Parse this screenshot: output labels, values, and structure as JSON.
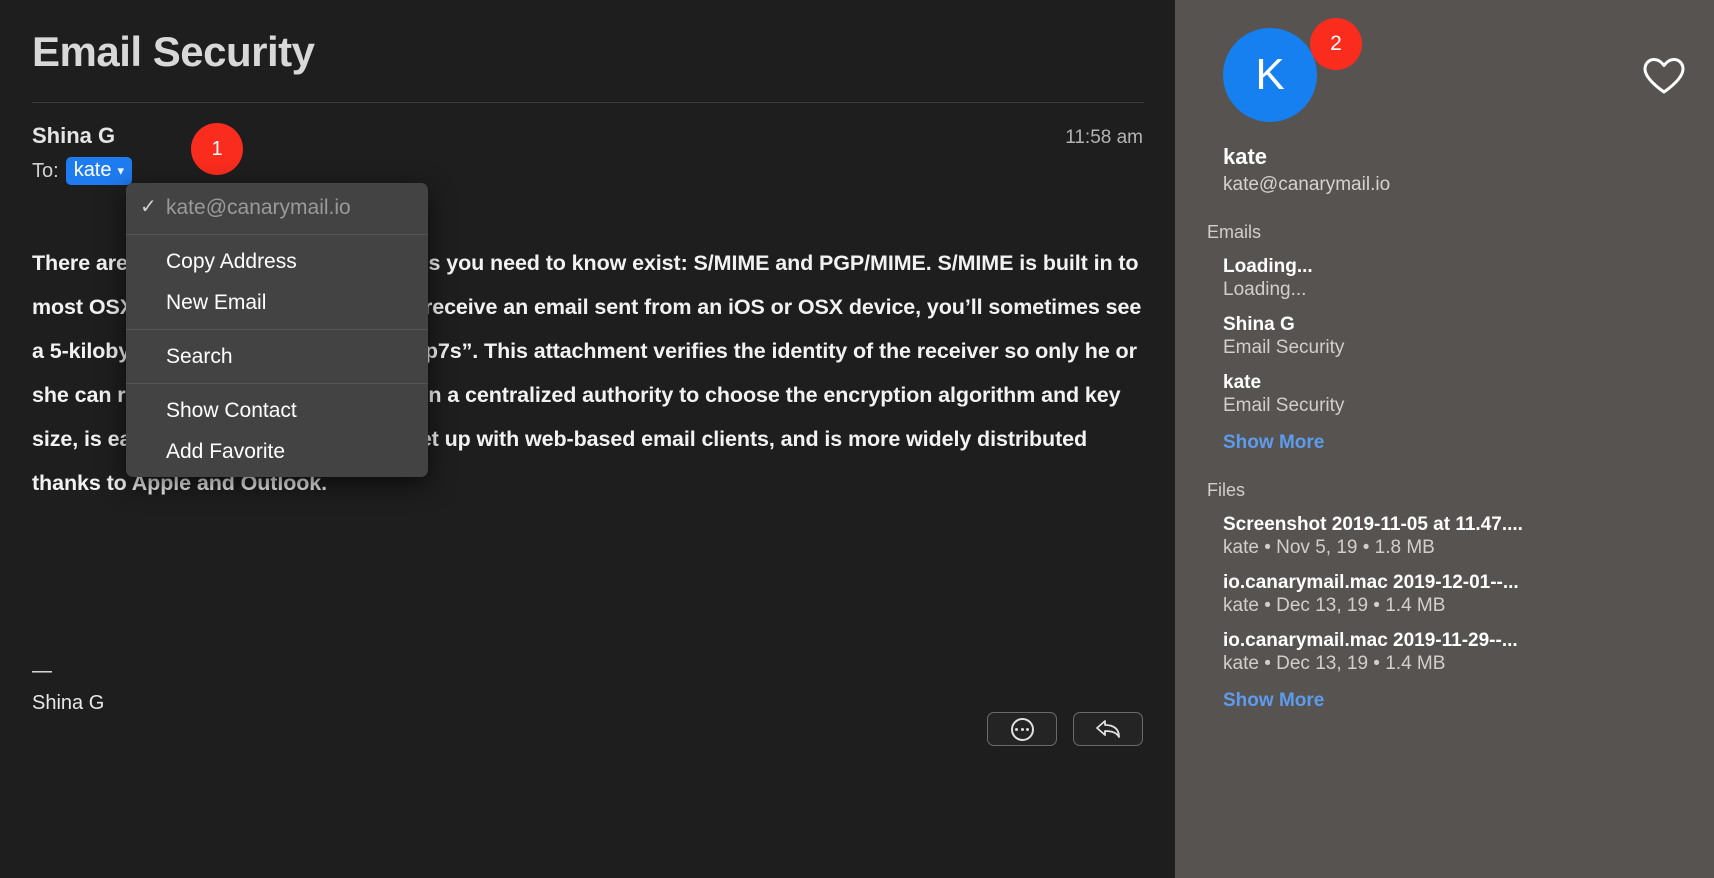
{
  "message": {
    "subject": "Email Security",
    "sender": "Shina G",
    "to_label": "To:",
    "recipient_token": "kate",
    "timestamp": "11:58 am",
    "body": "There are two email encryption methods you need to know exist: S/MIME and PGP/MIME. S/MIME is built in to most OSX and iOS devices. When you receive an email sent from an iOS or OSX device, you’ll sometimes see a 5-kilobyte attachment called “smime.p7s”. This attachment verifies the identity of the receiver so only he or she can read the email. S/MIME relies on a centralized authority to choose the encryption algorithm and key size, is easy to maintain, is harder to set up with web-based email clients, and is more widely distributed thanks to Apple and Outlook.",
    "signature_dash": "—",
    "signature_name": "Shina G"
  },
  "annotations": {
    "badge_one": "1",
    "badge_two": "2"
  },
  "context_menu": {
    "checked_item": "kate@canarymail.io",
    "check_glyph": "✓",
    "groups": [
      [
        "Copy Address",
        "New Email"
      ],
      [
        "Search"
      ],
      [
        "Show Contact",
        "Add Favorite"
      ]
    ]
  },
  "sidebar": {
    "avatar_initial": "K",
    "contact_name": "kate",
    "contact_email": "kate@canarymail.io",
    "emails_label": "Emails",
    "emails": [
      {
        "title": "Loading...",
        "sub": "Loading..."
      },
      {
        "title": "Shina G",
        "sub": "Email Security"
      },
      {
        "title": "kate",
        "sub": "Email Security"
      }
    ],
    "emails_show_more": "Show More",
    "files_label": "Files",
    "files": [
      {
        "title": "Screenshot 2019-11-05 at 11.47....",
        "sub": "kate • Nov 5, 19 • 1.8 MB"
      },
      {
        "title": "io.canarymail.mac 2019-12-01--...",
        "sub": "kate • Dec 13, 19 • 1.4 MB"
      },
      {
        "title": "io.canarymail.mac 2019-11-29--...",
        "sub": "kate • Dec 13, 19 • 1.4 MB"
      }
    ],
    "files_show_more": "Show More"
  },
  "colors": {
    "accent_blue": "#1f7bf0",
    "badge_red": "#fa2c1e",
    "link_blue": "#5d9ced",
    "sidebar_bg": "#575350",
    "pane_bg": "#1e1e1e"
  }
}
